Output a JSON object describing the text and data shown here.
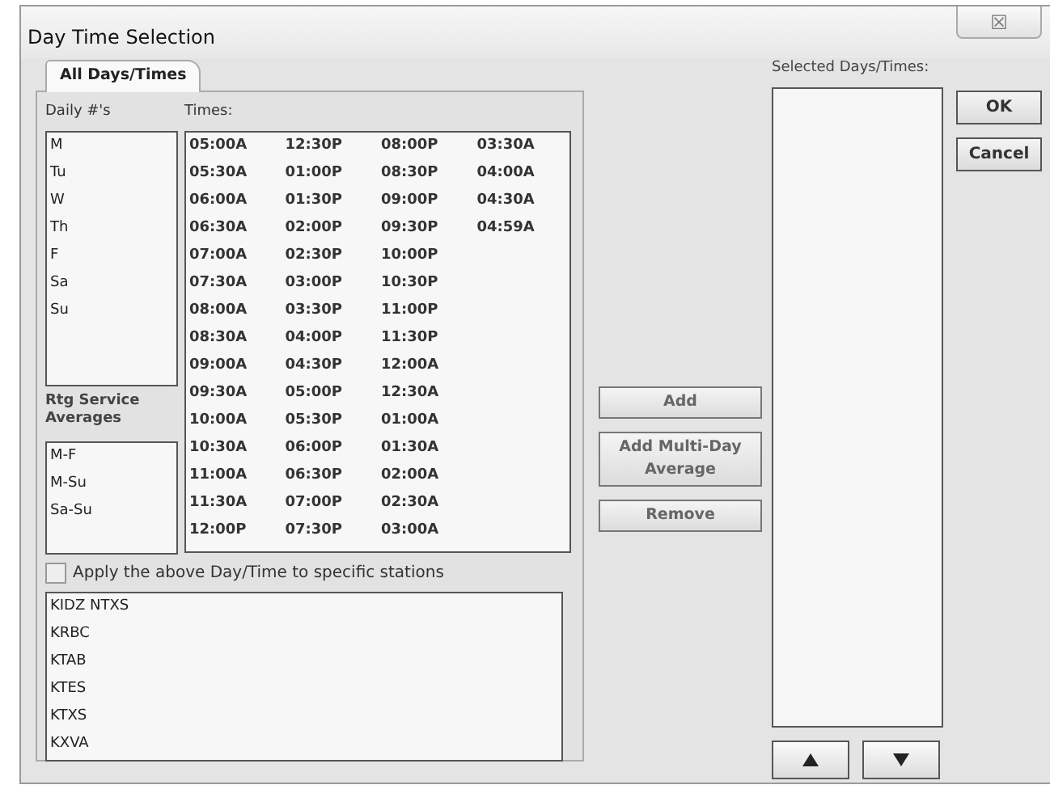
{
  "window": {
    "title": "Day Time Selection",
    "close_symbol": "☒"
  },
  "tabs": [
    {
      "label": "All Days/Times",
      "selected": true
    }
  ],
  "daily": {
    "label": "Daily #'s",
    "items": [
      "M",
      "Tu",
      "W",
      "Th",
      "F",
      "Sa",
      "Su"
    ]
  },
  "times": {
    "label": "Times:",
    "columns": [
      [
        "05:00A",
        "05:30A",
        "06:00A",
        "06:30A",
        "07:00A",
        "07:30A",
        "08:00A",
        "08:30A",
        "09:00A",
        "09:30A",
        "10:00A",
        "10:30A",
        "11:00A",
        "11:30A",
        "12:00P"
      ],
      [
        "12:30P",
        "01:00P",
        "01:30P",
        "02:00P",
        "02:30P",
        "03:00P",
        "03:30P",
        "04:00P",
        "04:30P",
        "05:00P",
        "05:30P",
        "06:00P",
        "06:30P",
        "07:00P",
        "07:30P"
      ],
      [
        "08:00P",
        "08:30P",
        "09:00P",
        "09:30P",
        "10:00P",
        "10:30P",
        "11:00P",
        "11:30P",
        "12:00A",
        "12:30A",
        "01:00A",
        "01:30A",
        "02:00A",
        "02:30A",
        "03:00A"
      ],
      [
        "03:30A",
        "04:00A",
        "04:30A",
        "04:59A"
      ]
    ]
  },
  "averages": {
    "label": "Rtg Service Averages",
    "items": [
      "M-F",
      "M-Su",
      "Sa-Su"
    ]
  },
  "apply_stations": {
    "label": "Apply the above Day/Time to specific stations",
    "checked": false
  },
  "stations": [
    "KIDZ NTXS",
    "KRBC",
    "KTAB",
    "KTES",
    "KTXS",
    "KXVA"
  ],
  "middle_buttons": [
    "Add",
    "Add Multi-Day Average",
    "Remove"
  ],
  "selected": {
    "label": "Selected Days/Times:"
  },
  "dialog_buttons": [
    "OK",
    "Cancel"
  ]
}
